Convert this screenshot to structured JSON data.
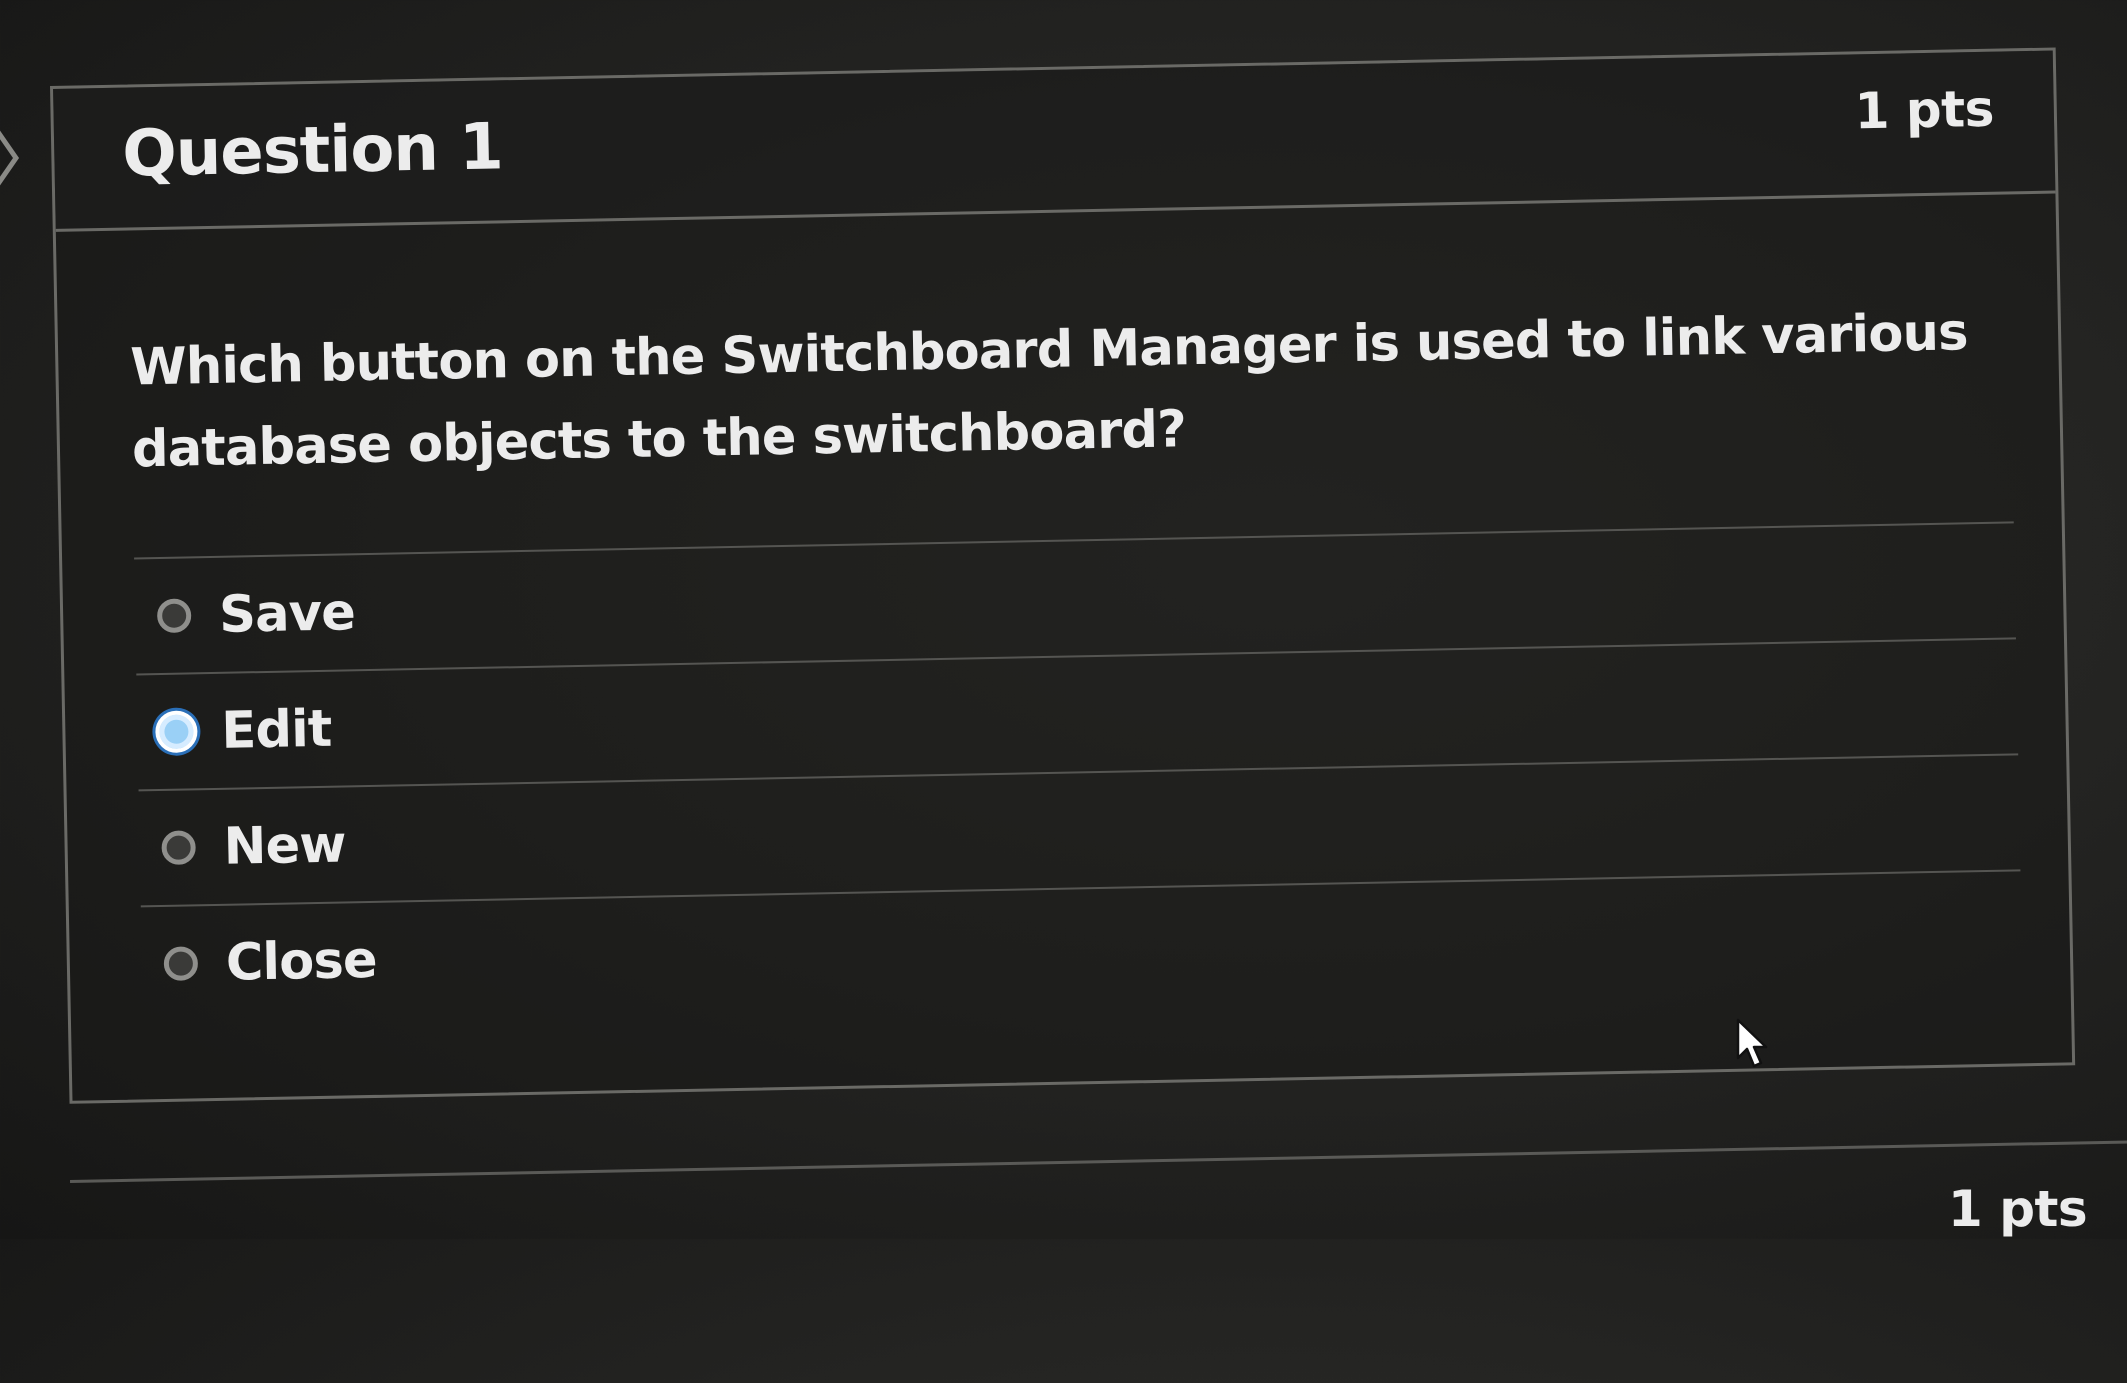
{
  "question": {
    "title": "Question 1",
    "points": "1 pts",
    "text": "Which button on the Switchboard Manager is used to link various database objects to the switchboard?",
    "answers": [
      {
        "label": "Save",
        "selected": false
      },
      {
        "label": "Edit",
        "selected": true
      },
      {
        "label": "New",
        "selected": false
      },
      {
        "label": "Close",
        "selected": false
      }
    ]
  },
  "next_question": {
    "points": "1 pts"
  },
  "icons": {
    "left_nav": "chevron-right-icon",
    "pointer": "mouse-pointer-icon",
    "radio": "radio-button-icon"
  },
  "colors": {
    "background": "#252523",
    "text": "#ececec",
    "border": "#6a6a66",
    "selected_radio": "#9ad0f6",
    "selected_ring": "#2a6fb8"
  }
}
